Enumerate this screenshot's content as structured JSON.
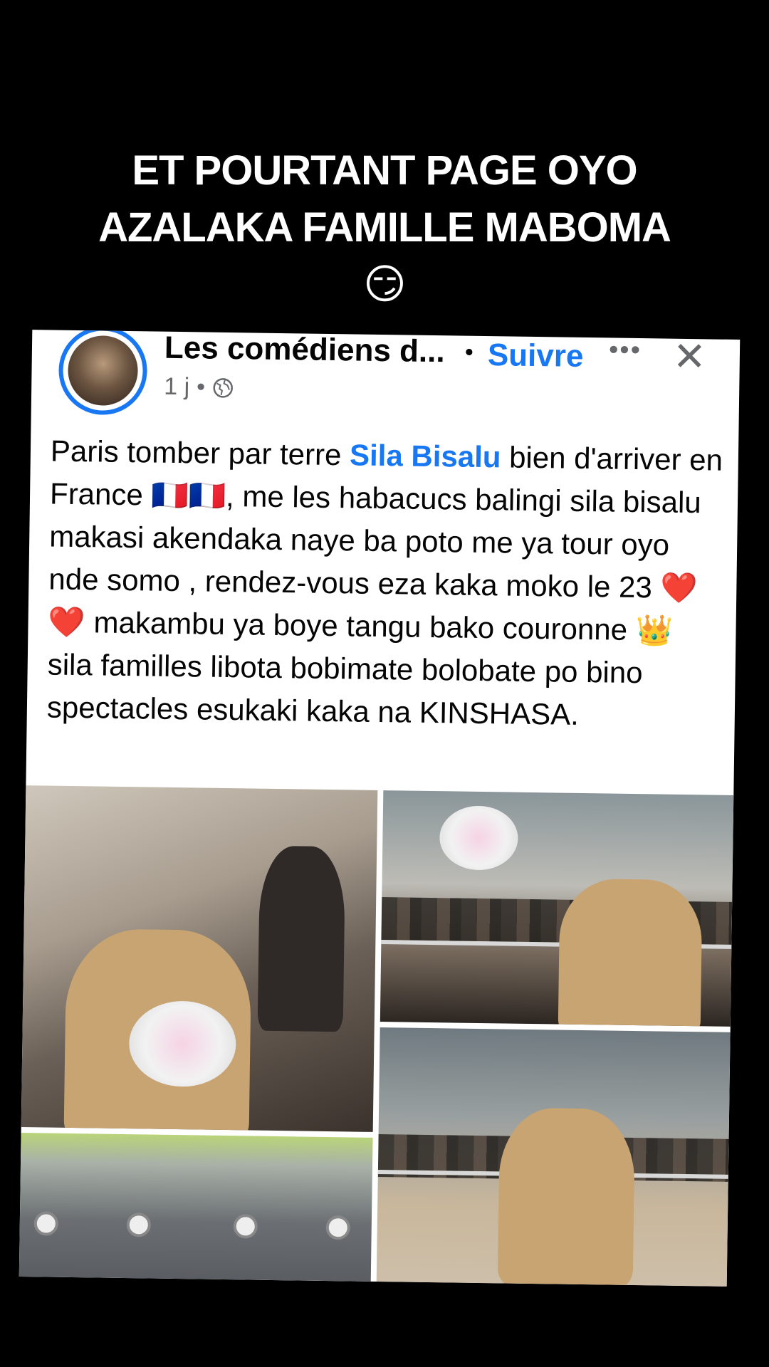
{
  "overlay": {
    "caption": "ET POURTANT PAGE OYO AZALAKA FAMILLE MABOMA😏"
  },
  "post": {
    "page_name": "Les comédiens d...",
    "separator": "•",
    "follow_label": "Suivre",
    "more_label": "•••",
    "close_label": "✕",
    "time": "1 j",
    "meta_separator": "•",
    "privacy_icon": "globe-icon",
    "text": {
      "part1": "Paris tomber par terre ",
      "mention": "Sila Bisalu",
      "part2": " bien d'arriver en France 🇫🇷🇫🇷, me les habacucs balingi sila bisalu makasi akendaka naye ba poto me ya tour oyo nde somo , rendez-vous eza kaka moko le 23 ❤️❤️ makambu ya boye tangu bako couronne 👑 sila familles libota bobimate bolobate po bino spectacles esukaki kaka na KINSHASA."
    },
    "photo_count": 4
  },
  "colors": {
    "background": "#000000",
    "card": "#ffffff",
    "link": "#1877f2",
    "secondary": "#65676b"
  }
}
